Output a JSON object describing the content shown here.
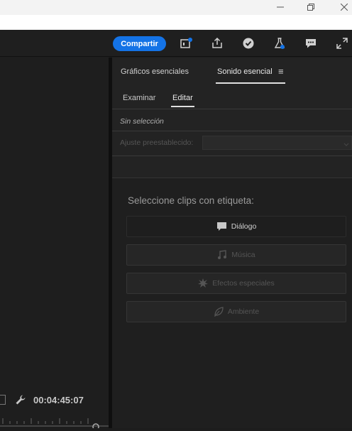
{
  "window_controls": {
    "minimize": "—",
    "restore": "❐",
    "close": "✕"
  },
  "header": {
    "share_label": "Compartir",
    "icons": [
      "quick-export-icon",
      "publish-icon",
      "check-icon",
      "flask-icon",
      "feedback-icon",
      "fullscreen-icon"
    ],
    "accent": "#1473e6"
  },
  "panel": {
    "tabs": [
      {
        "label": "Gráficos esenciales"
      },
      {
        "label": "Sonido esencial"
      }
    ],
    "menu_icon": "≡",
    "subtabs": [
      {
        "label": "Examinar"
      },
      {
        "label": "Editar"
      }
    ],
    "no_selection": "Sin selección",
    "preset_label": "Ajuste preestablecido:",
    "prompt": "Seleccione clips con etiqueta:",
    "clip_types": [
      {
        "label": "Diálogo",
        "icon": "speech-bubble-icon",
        "enabled": true
      },
      {
        "label": "Música",
        "icon": "music-note-icon",
        "enabled": false
      },
      {
        "label": "Efectos especiales",
        "icon": "burst-icon",
        "enabled": false
      },
      {
        "label": "Ambiente",
        "icon": "leaf-icon",
        "enabled": false
      }
    ]
  },
  "timeline": {
    "timecode": "00:04:45:07"
  }
}
